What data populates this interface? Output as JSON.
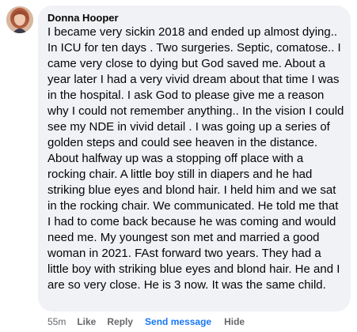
{
  "comment": {
    "author": "Donna Hooper",
    "text": "I became very sickin 2018 and ended up almost dying.. In ICU for ten days . Two surgeries. Septic, comatose.. I came very close to dying but God saved me. About a year later I had a very vivid dream about that time I was in the hospital. I ask God to please give me a reason why I could not remember anything.. In the vision I could see my NDE in vivid detail . I was going up a series of golden steps and could see heaven in the distance. About halfway up was a stopping off place with a rocking chair. A little boy still in diapers and he had striking blue eyes and blond hair. I held him and we sat in the rocking chair. We communicated. He told me that I had to come back because he was coming and would need me. My youngest son met and married a good woman in 2021. FAst forward two years. They had a little boy with striking blue eyes and blond hair. He and I are so very close. He is 3 now. It was the same child.",
    "timestamp": "55m",
    "actions": {
      "like": "Like",
      "reply": "Reply",
      "send_message": "Send message",
      "hide": "Hide"
    }
  },
  "colors": {
    "bubble_bg": "#f0f2f5",
    "text": "#050505",
    "meta": "#65676b",
    "link": "#1877f2"
  }
}
